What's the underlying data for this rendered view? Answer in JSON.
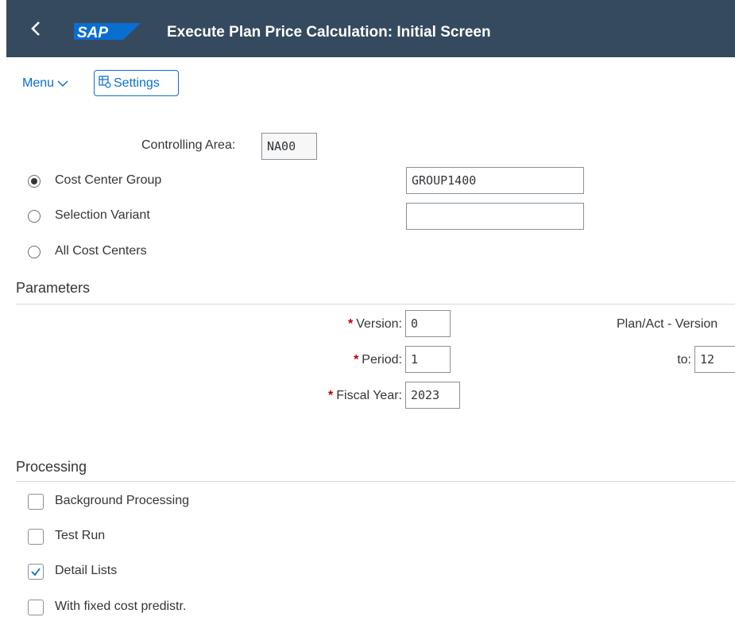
{
  "shell": {
    "back_icon": "chevron-left-icon",
    "logo": "SAP",
    "title": "Execute Plan Price Calculation: Initial Screen",
    "bg_color": "#354a5f"
  },
  "toolbar": {
    "menu_label": "Menu",
    "settings_label": "Settings"
  },
  "selection": {
    "controlling_area_label": "Controlling Area:",
    "controlling_area_value": "NA00",
    "options": [
      {
        "label": "Cost Center Group",
        "selected": true,
        "value": "GROUP1400"
      },
      {
        "label": "Selection Variant",
        "selected": false,
        "value": ""
      },
      {
        "label": "All Cost Centers",
        "selected": false
      }
    ]
  },
  "parameters": {
    "title": "Parameters",
    "version_label": "Version:",
    "version_value": "0",
    "version_desc": "Plan/Act - Version",
    "period_label": "Period:",
    "period_value": "1",
    "to_label": "to:",
    "to_value": "12",
    "fiscal_year_label": "Fiscal Year:",
    "fiscal_year_value": "2023",
    "required_marker": "*"
  },
  "processing": {
    "title": "Processing",
    "options": [
      {
        "label": "Background Processing",
        "checked": false
      },
      {
        "label": "Test Run",
        "checked": false
      },
      {
        "label": "Detail Lists",
        "checked": true
      },
      {
        "label": "With fixed cost predistr.",
        "checked": false
      }
    ]
  }
}
